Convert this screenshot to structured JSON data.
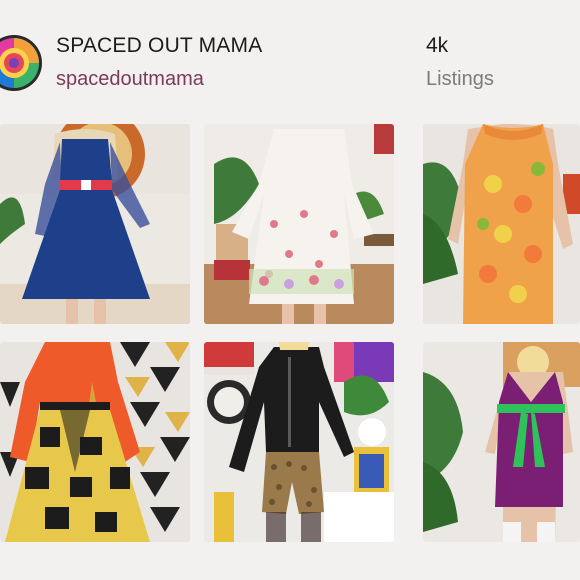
{
  "shop": {
    "name": "SPACED OUT MAMA",
    "handle": "spacedoutmama",
    "listings_count": "4k",
    "listings_label": "Listings"
  },
  "listings": [
    {
      "item": "navy-blue-dress",
      "colors": [
        "#1e3f8a",
        "#e23a4a"
      ]
    },
    {
      "item": "white-floral-dress",
      "colors": [
        "#f4f0ec",
        "#e07a8a"
      ]
    },
    {
      "item": "orange-yellow-floral-shift-dress",
      "colors": [
        "#f0a24a",
        "#f2d14a"
      ]
    },
    {
      "item": "orange-blouse-patchwork-skirt",
      "colors": [
        "#ee5a2a",
        "#e8c84a"
      ]
    },
    {
      "item": "black-shirt-print-shorts",
      "colors": [
        "#1c1c1c",
        "#9a7a4a"
      ]
    },
    {
      "item": "purple-dress-green-sash",
      "colors": [
        "#7a1f74",
        "#2fc25a"
      ]
    }
  ]
}
